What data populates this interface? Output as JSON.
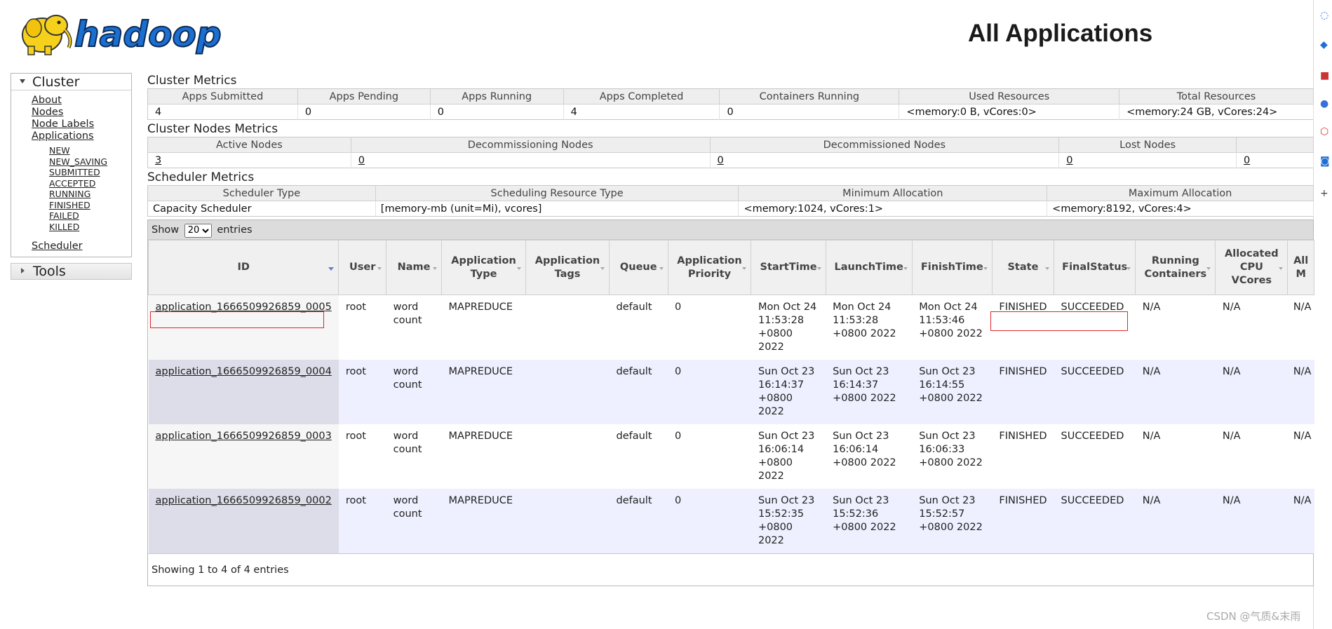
{
  "header": {
    "logo_text": "hadoop",
    "title": "All Applications"
  },
  "nav": {
    "cluster_label": "Cluster",
    "links": [
      "About",
      "Nodes",
      "Node Labels",
      "Applications"
    ],
    "sub_links": [
      "NEW",
      "NEW_SAVING",
      "SUBMITTED",
      "ACCEPTED",
      "RUNNING",
      "FINISHED",
      "FAILED",
      "KILLED"
    ],
    "scheduler_link": "Scheduler",
    "tools_label": "Tools"
  },
  "cluster_metrics": {
    "title": "Cluster Metrics",
    "headers": [
      "Apps Submitted",
      "Apps Pending",
      "Apps Running",
      "Apps Completed",
      "Containers Running",
      "Used Resources",
      "Total Resources"
    ],
    "values": [
      "4",
      "0",
      "0",
      "4",
      "0",
      "<memory:0 B, vCores:0>",
      "<memory:24 GB, vCores:24>"
    ]
  },
  "cluster_nodes_metrics": {
    "title": "Cluster Nodes Metrics",
    "headers": [
      "Active Nodes",
      "Decommissioning Nodes",
      "Decommissioned Nodes",
      "Lost Nodes",
      ""
    ],
    "values": [
      "3",
      "0",
      "0",
      "0",
      "0"
    ]
  },
  "scheduler_metrics": {
    "title": "Scheduler Metrics",
    "headers": [
      "Scheduler Type",
      "Scheduling Resource Type",
      "Minimum Allocation",
      "Maximum Allocation"
    ],
    "values": [
      "Capacity Scheduler",
      "[memory-mb (unit=Mi), vcores]",
      "<memory:1024, vCores:1>",
      "<memory:8192, vCores:4>"
    ]
  },
  "apps": {
    "show_label": "Show",
    "entries_label": "entries",
    "page_size": "20",
    "columns": [
      "ID",
      "User",
      "Name",
      "Application Type",
      "Application Tags",
      "Queue",
      "Application Priority",
      "StartTime",
      "LaunchTime",
      "FinishTime",
      "State",
      "FinalStatus",
      "Running Containers",
      "Allocated CPU VCores",
      "All M"
    ],
    "rows": [
      {
        "id": "application_1666509926859_0005",
        "user": "root",
        "name": "word count",
        "type": "MAPREDUCE",
        "tags": "",
        "queue": "default",
        "priority": "0",
        "start": "Mon Oct 24 11:53:28 +0800 2022",
        "launch": "Mon Oct 24 11:53:28 +0800 2022",
        "finish": "Mon Oct 24 11:53:46 +0800 2022",
        "state": "FINISHED",
        "final": "SUCCEEDED",
        "containers": "N/A",
        "vcores": "N/A",
        "mem": "N/A"
      },
      {
        "id": "application_1666509926859_0004",
        "user": "root",
        "name": "word count",
        "type": "MAPREDUCE",
        "tags": "",
        "queue": "default",
        "priority": "0",
        "start": "Sun Oct 23 16:14:37 +0800 2022",
        "launch": "Sun Oct 23 16:14:37 +0800 2022",
        "finish": "Sun Oct 23 16:14:55 +0800 2022",
        "state": "FINISHED",
        "final": "SUCCEEDED",
        "containers": "N/A",
        "vcores": "N/A",
        "mem": "N/A"
      },
      {
        "id": "application_1666509926859_0003",
        "user": "root",
        "name": "word count",
        "type": "MAPREDUCE",
        "tags": "",
        "queue": "default",
        "priority": "0",
        "start": "Sun Oct 23 16:06:14 +0800 2022",
        "launch": "Sun Oct 23 16:06:14 +0800 2022",
        "finish": "Sun Oct 23 16:06:33 +0800 2022",
        "state": "FINISHED",
        "final": "SUCCEEDED",
        "containers": "N/A",
        "vcores": "N/A",
        "mem": "N/A"
      },
      {
        "id": "application_1666509926859_0002",
        "user": "root",
        "name": "word count",
        "type": "MAPREDUCE",
        "tags": "",
        "queue": "default",
        "priority": "0",
        "start": "Sun Oct 23 15:52:35 +0800 2022",
        "launch": "Sun Oct 23 15:52:36 +0800 2022",
        "finish": "Sun Oct 23 15:52:57 +0800 2022",
        "state": "FINISHED",
        "final": "SUCCEEDED",
        "containers": "N/A",
        "vcores": "N/A",
        "mem": "N/A"
      }
    ],
    "footer": "Showing 1 to 4 of 4 entries"
  },
  "watermark": "CSDN @气质&末雨",
  "colors": {
    "highlight_box": "#e0262b",
    "logo_blue": "#1a6fd0",
    "logo_yellow": "#f6d11c"
  }
}
